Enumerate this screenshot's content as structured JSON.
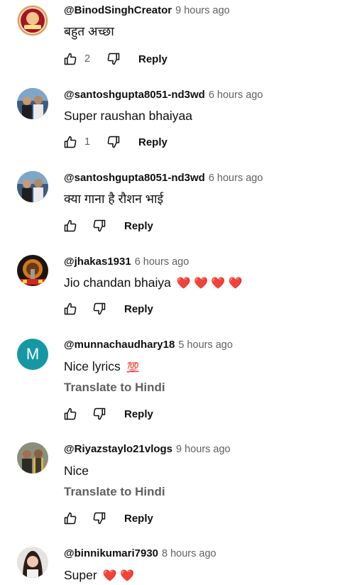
{
  "comments": [
    {
      "handle": "@BinodSinghCreator",
      "time": "9 hours ago",
      "text": "बहुत अच्छा",
      "likes": "2",
      "reply_label": "Reply",
      "avatar_icon": "profile-photo"
    },
    {
      "handle": "@santoshgupta8051-nd3wd",
      "time": "6 hours ago",
      "text": "Super raushan bhaiyaa",
      "likes": "1",
      "reply_label": "Reply",
      "avatar_icon": "profile-photo"
    },
    {
      "handle": "@santoshgupta8051-nd3wd",
      "time": "6 hours ago",
      "text": "क्या गाना है रौशन भाई",
      "likes": "",
      "reply_label": "Reply",
      "avatar_icon": "profile-photo"
    },
    {
      "handle": "@jhakas1931",
      "time": "6 hours ago",
      "text": "Jio chandan bhaiya",
      "text_emojis": "❤️ ❤️ ❤️ ❤️",
      "likes": "",
      "reply_label": "Reply",
      "avatar_icon": "profile-photo"
    },
    {
      "handle": "@munnachaudhary18",
      "time": "5 hours ago",
      "text": "Nice lyrics",
      "text_emojis": "💯",
      "translate_label": "Translate to Hindi",
      "likes": "",
      "reply_label": "Reply",
      "avatar_letter": "M",
      "avatar_color": "#1598a4"
    },
    {
      "handle": "@Riyazstaylo21vlogs",
      "time": "9 hours ago",
      "text": "Nice",
      "translate_label": "Translate to Hindi",
      "likes": "",
      "reply_label": "Reply",
      "avatar_icon": "profile-photo"
    },
    {
      "handle": "@binnikumari7930",
      "time": "8 hours ago",
      "text": "Super",
      "text_emojis": "❤️ ❤️",
      "avatar_icon": "profile-photo"
    }
  ],
  "icons": {
    "like": "thumbs-up-icon",
    "dislike": "thumbs-down-icon"
  }
}
